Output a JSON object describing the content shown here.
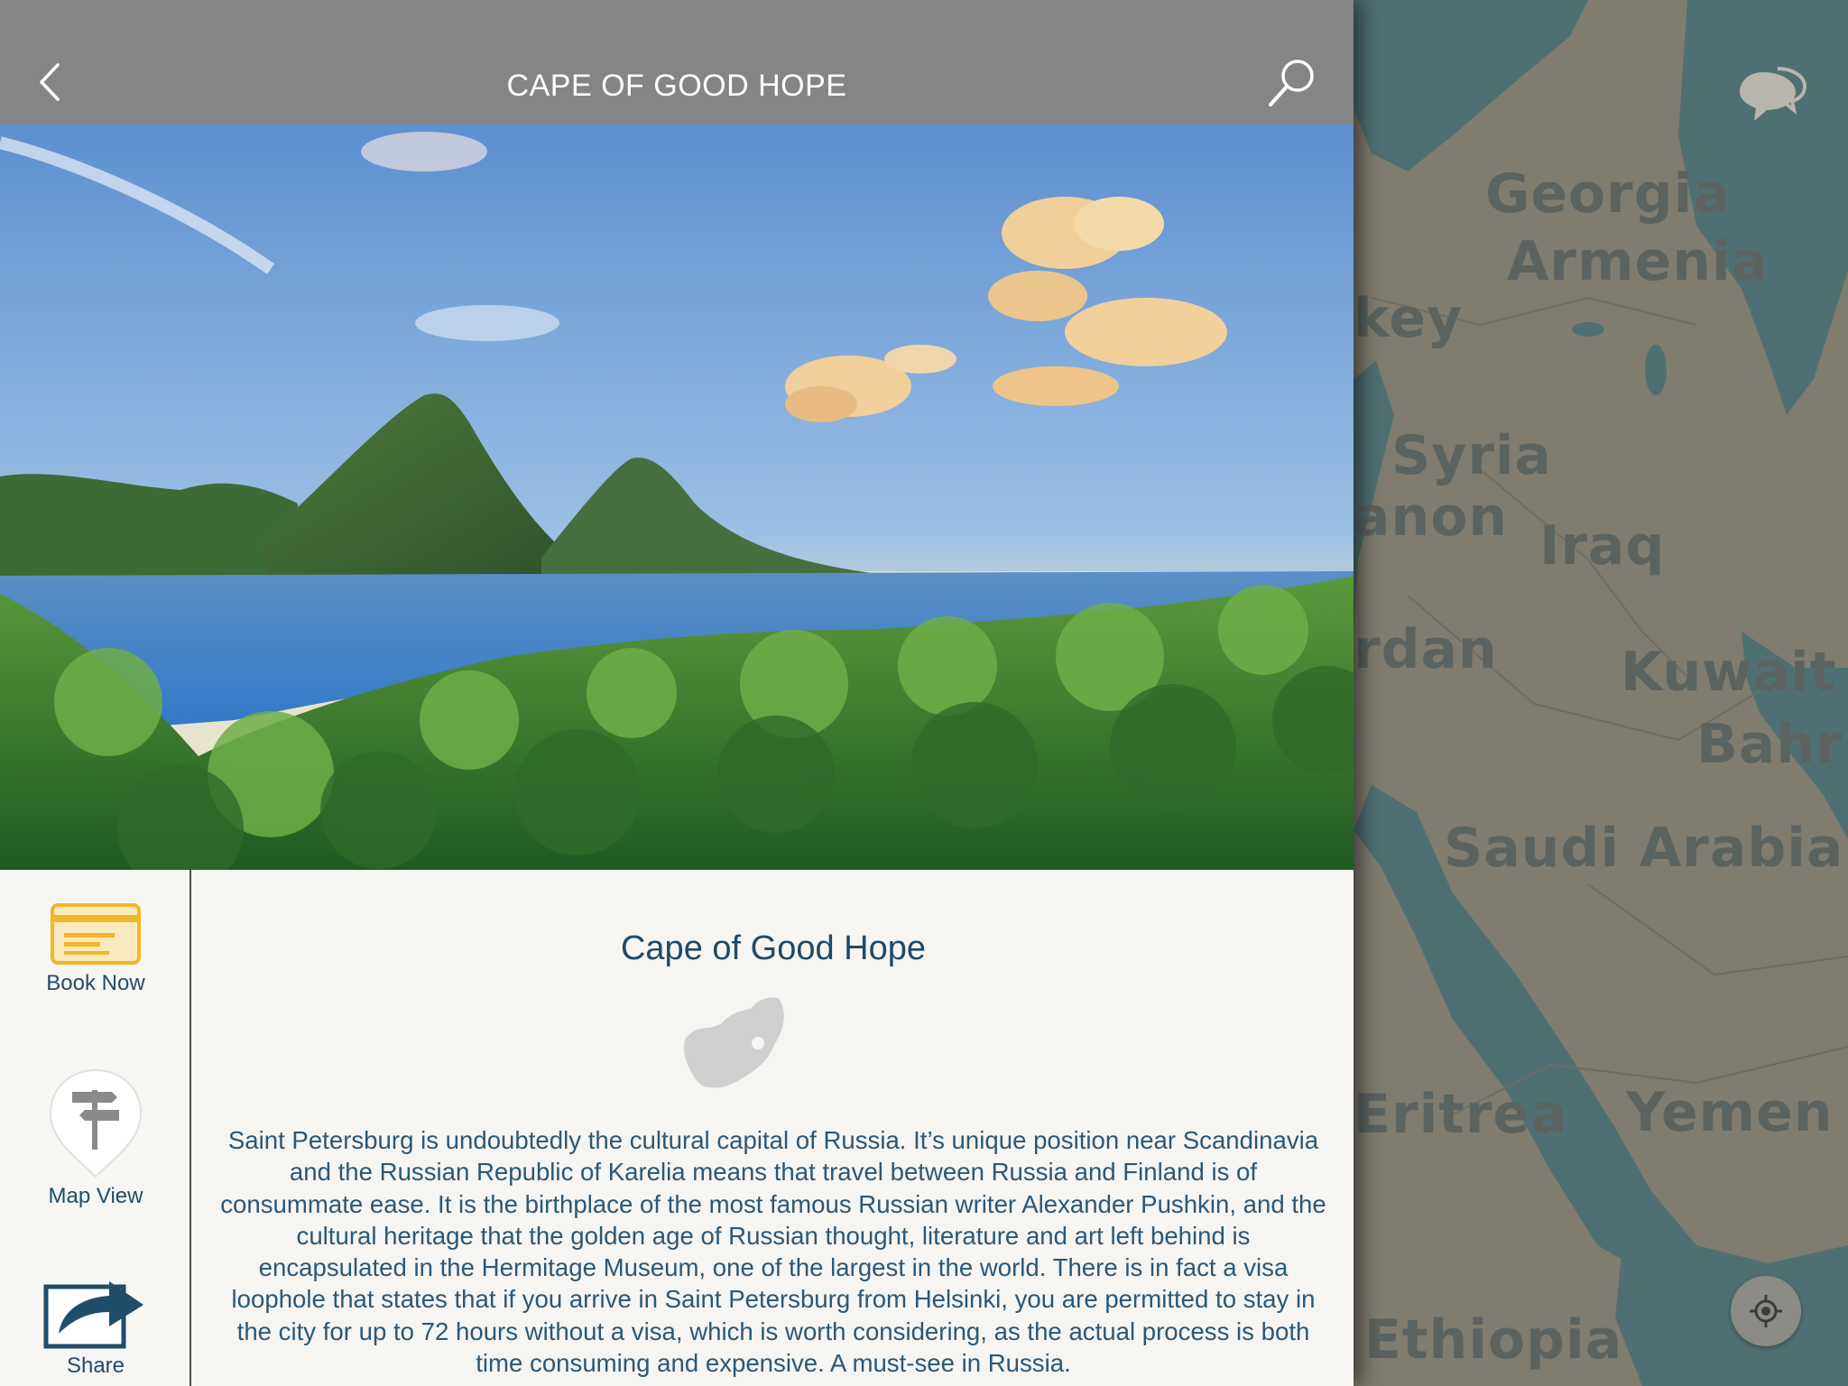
{
  "header": {
    "title": "CAPE OF GOOD HOPE"
  },
  "hero": {
    "alt": "Coastal landscape with twin peaks, blue bay and green forest"
  },
  "actions": {
    "book_now": "Book Now",
    "map_view": "Map View",
    "share": "Share"
  },
  "detail": {
    "title": "Cape of Good Hope",
    "description": "Saint Petersburg is undoubtedly the cultural capital of Russia. It’s unique position near Scandinavia and the Russian Republic of Karelia means that travel between Russia and Finland is of consummate ease. It is the birthplace of the most famous Russian writer Alexander Pushkin, and the cultural heritage that the golden age of Russian thought, literature and art left behind is encapsulated in the Hermitage Museum, one of the largest in the world. There is in fact a visa loophole that states that if you arrive in Saint Petersburg from Helsinki, you are permitted to stay in the city for up to 72 hours without a visa, which is worth considering, as the actual process is both time consuming and expensive. A must-see in Russia."
  },
  "map": {
    "labels": {
      "georgia": "Georgia",
      "armenia": "Armenia",
      "turkey": "key",
      "syria": "Syria",
      "lebanon": "anon",
      "iraq": "Iraq",
      "jordan": "rdan",
      "kuwait": "Kuwait",
      "bahrain": "Bahr",
      "saudi": "Saudi Arabia",
      "eritrea": "Eritrea",
      "yemen": "Yemen",
      "ethiopia": "Ethiopia"
    }
  },
  "colors": {
    "topbar": "#858585",
    "accent_text": "#1f4a67",
    "book_icon": "#f2b62b",
    "share_icon": "#1f4d6a",
    "map_land": "#a49d8d",
    "map_water": "#5f8c91"
  }
}
